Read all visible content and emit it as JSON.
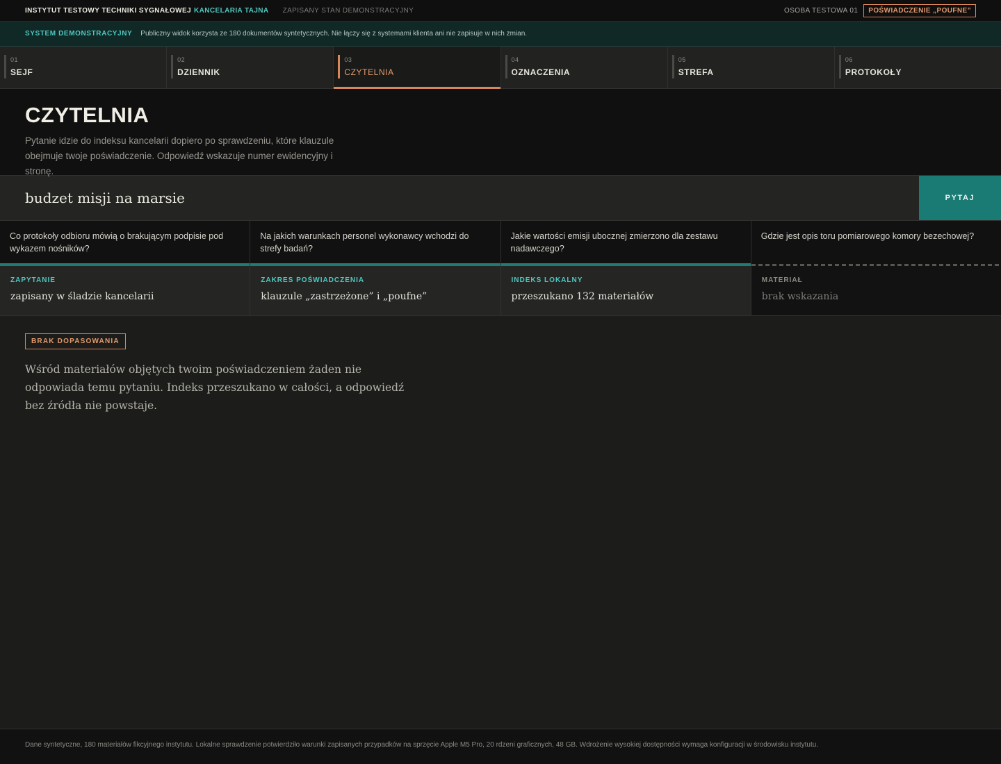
{
  "topbar": {
    "institute": "INSTYTUT TESTOWY TECHNIKI SYGNAŁOWEJ",
    "chancery": "KANCELARIA TAJNA",
    "saved_state": "ZAPISANY STAN DEMONSTRACYJNY",
    "person": "OSOBA TESTOWA 01",
    "clearance": "POŚWIADCZENIE „POUFNE”"
  },
  "banner": {
    "tag": "SYSTEM DEMONSTRACYJNY",
    "text": "Publiczny widok korzysta ze 180 dokumentów syntetycznych. Nie łączy się z systemami klienta ani nie zapisuje w nich zmian."
  },
  "tabs": [
    {
      "num": "01",
      "label": "SEJF"
    },
    {
      "num": "02",
      "label": "DZIENNIK"
    },
    {
      "num": "03",
      "label": "CZYTELNIA"
    },
    {
      "num": "04",
      "label": "OZNACZENIA"
    },
    {
      "num": "05",
      "label": "STREFA"
    },
    {
      "num": "06",
      "label": "PROTOKOŁY"
    }
  ],
  "header": {
    "title": "CZYTELNIA",
    "description": "Pytanie idzie do indeksu kancelarii dopiero po sprawdzeniu, które klauzule obejmuje twoje poświadczenie. Odpowiedź wskazuje numer ewidencyjny i stronę."
  },
  "search": {
    "value": "budzet misji na marsie",
    "button": "PYTAJ"
  },
  "suggestions": [
    "Co protokoły odbioru mówią o brakującym podpisie pod wykazem nośników?",
    "Na jakich warunkach personel wykonawcy wchodzi do strefy badań?",
    "Jakie wartości emisji ubocznej zmierzono dla zestawu nadawczego?",
    "Gdzie jest opis toru pomiarowego komory bezechowej?"
  ],
  "status": [
    {
      "label": "ZAPYTANIE",
      "value": "zapisany w śladzie kancelarii"
    },
    {
      "label": "ZAKRES POŚWIADCZENIA",
      "value": "klauzule „zastrzeżone” i „poufne”"
    },
    {
      "label": "INDEKS LOKALNY",
      "value": "przeszukano 132 materiałów"
    },
    {
      "label": "MATERIAŁ",
      "value": "brak wskazania"
    }
  ],
  "result": {
    "badge": "BRAK DOPASOWANIA",
    "text": "Wśród materiałów objętych twoim poświadczeniem żaden nie odpowiada temu pytaniu. Indeks przeszukano w całości, a odpowiedź bez źródła nie powstaje."
  },
  "footer": {
    "text": "Dane syntetyczne, 180 materiałów fikcyjnego instytutu. Lokalne sprawdzenie potwierdziło warunki zapisanych przypadków na sprzęcie Apple M5 Pro, 20 rdzeni graficznych, 48 GB. Wdrożenie wysokiej dostępności wymaga konfiguracji w środowisku instytutu."
  },
  "colors": {
    "accent_teal": "#4fc8c0",
    "accent_orange": "#d8875a",
    "button_teal": "#1a7a74"
  }
}
